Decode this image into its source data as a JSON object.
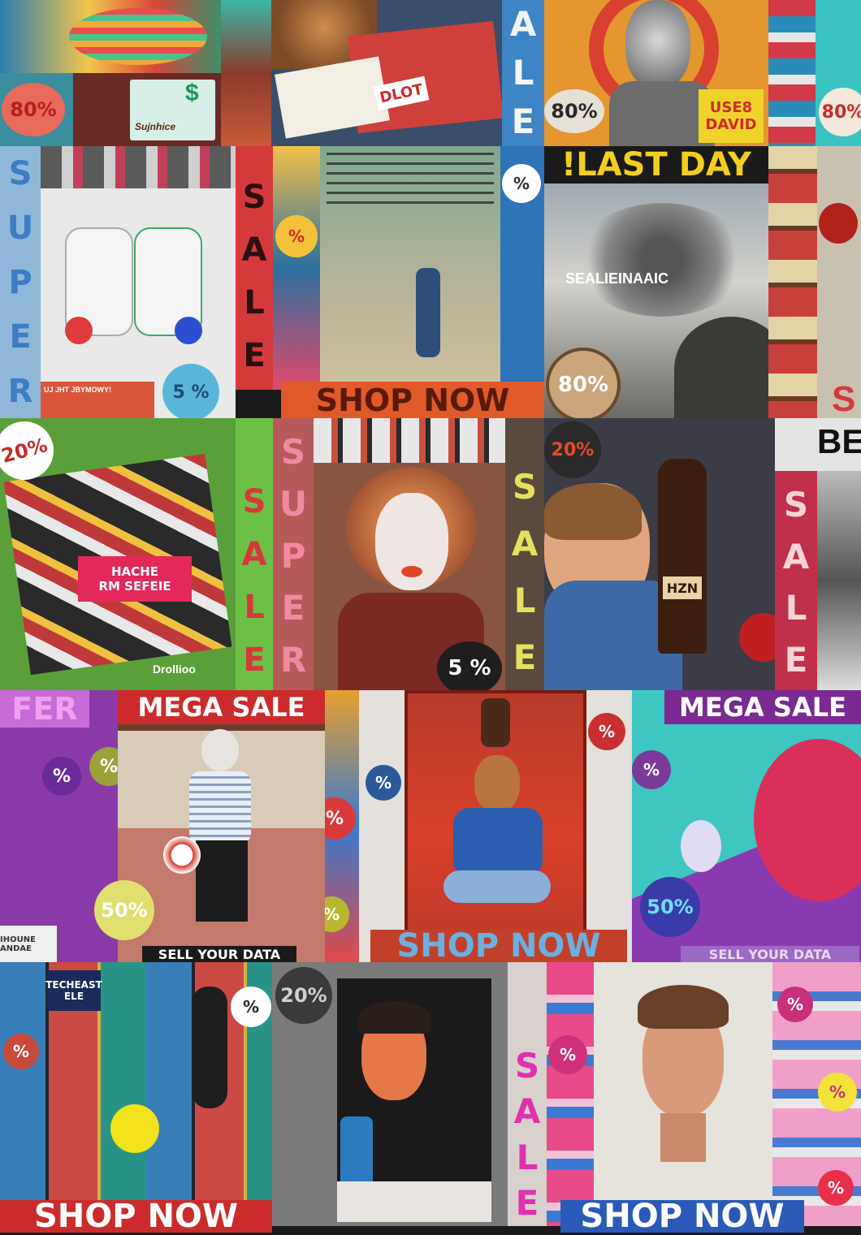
{
  "row1": {
    "badge_80_left": "80%",
    "dollar": "$",
    "card_brand": "Sujnhice",
    "small_sign": "DLOT",
    "vertical_ale": [
      "A",
      "L",
      "E"
    ],
    "badge_80_mid": "80%",
    "yellow_sign": [
      "USE8",
      "DAVID"
    ],
    "badge_80_right": "80%"
  },
  "row2": {
    "super_left": [
      "S",
      "U",
      "P",
      "E",
      "R"
    ],
    "sale_red": [
      "S",
      "A",
      "L",
      "E"
    ],
    "badge_5": "5 %",
    "badge_pct": "%",
    "last_day": "!LAST DAY",
    "smoke_text": "SEALIEINAAIC",
    "badge_80": "80%",
    "shop_now": "SHOP NOW",
    "right_s": "S",
    "tiny_caption": "UJ JHT JBYMOWY!"
  },
  "row3": {
    "badge_20_left": "20%",
    "sale_green": [
      "S",
      "A",
      "L",
      "E"
    ],
    "super_pink": [
      "S",
      "U",
      "P",
      "E",
      "R"
    ],
    "sale_right_of_face": [
      "S",
      "A",
      "L",
      "E"
    ],
    "badge_5": "5 %",
    "badge_20_mid": "20%",
    "bottle_label": "HZN",
    "sale_red_right": [
      "S",
      "A",
      "L",
      "E"
    ],
    "partial_be": "BE",
    "pink_board": [
      "HACHE",
      "RM SEFEIE"
    ],
    "corner_tag": "Drollioo"
  },
  "row4": {
    "fer": "FER",
    "mega_sale_left": "MEGA SALE",
    "mega_sale_right": "MEGA SALE",
    "pct_badges": [
      "%",
      "%",
      "%",
      "%",
      "%",
      "%",
      "%"
    ],
    "badge_50_left": "50%",
    "badge_50_right": "50%",
    "sell_data_left": "SELL YOUR DATA",
    "sell_data_right": "SELL YOUR DATA",
    "shop_now_mid": "SHOP NOW",
    "corner_label": "IHOUNE ANDAE"
  },
  "row5": {
    "pct_badges": [
      "%",
      "%",
      "%",
      "%",
      "%",
      "%"
    ],
    "badge_20": "20%",
    "sale_pink": [
      "S",
      "A",
      "L",
      "E"
    ],
    "shop_now_left": "SHOP NOW",
    "shop_now_right": "SHOP NOW",
    "poster_title": "TECHEAST ELE"
  },
  "colors": {
    "sale_red": "#d53a3a",
    "sale_pink": "#e8407a",
    "blue_letters": "#3d7dc4",
    "banner_red": "#cc2b2b",
    "purple": "#7a2a92",
    "yellow_text": "#ffd21e"
  }
}
